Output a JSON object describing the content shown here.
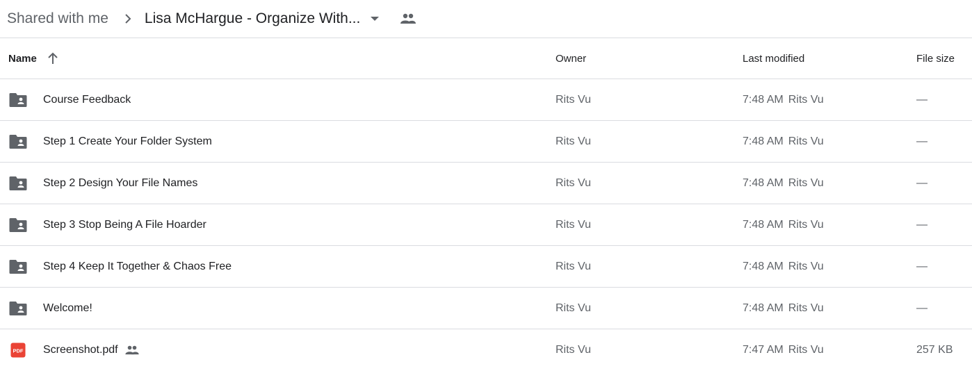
{
  "breadcrumb": {
    "root": "Shared with me",
    "current": "Lisa McHargue - Organize With..."
  },
  "columns": {
    "name": "Name",
    "owner": "Owner",
    "last_modified": "Last modified",
    "file_size": "File size",
    "sort_direction": "ascending"
  },
  "rows": [
    {
      "type": "shared-folder",
      "name": "Course Feedback",
      "owner": "Rits Vu",
      "modified_time": "7:48 AM",
      "modified_by": "Rits Vu",
      "size": "—",
      "shared": false
    },
    {
      "type": "shared-folder",
      "name": "Step 1 Create Your Folder System",
      "owner": "Rits Vu",
      "modified_time": "7:48 AM",
      "modified_by": "Rits Vu",
      "size": "—",
      "shared": false
    },
    {
      "type": "shared-folder",
      "name": "Step 2 Design Your File Names",
      "owner": "Rits Vu",
      "modified_time": "7:48 AM",
      "modified_by": "Rits Vu",
      "size": "—",
      "shared": false
    },
    {
      "type": "shared-folder",
      "name": "Step 3 Stop Being A File Hoarder",
      "owner": "Rits Vu",
      "modified_time": "7:48 AM",
      "modified_by": "Rits Vu",
      "size": "—",
      "shared": false
    },
    {
      "type": "shared-folder",
      "name": "Step 4 Keep It Together & Chaos Free",
      "owner": "Rits Vu",
      "modified_time": "7:48 AM",
      "modified_by": "Rits Vu",
      "size": "—",
      "shared": false
    },
    {
      "type": "shared-folder",
      "name": "Welcome!",
      "owner": "Rits Vu",
      "modified_time": "7:48 AM",
      "modified_by": "Rits Vu",
      "size": "—",
      "shared": false
    },
    {
      "type": "pdf",
      "name": "Screenshot.pdf",
      "owner": "Rits Vu",
      "modified_time": "7:47 AM",
      "modified_by": "Rits Vu",
      "size": "257 KB",
      "shared": true,
      "icon_label": "PDF"
    }
  ],
  "colors": {
    "folder_icon": "#5f6368",
    "pdf_icon": "#ea4335",
    "divider": "#dadce0"
  }
}
